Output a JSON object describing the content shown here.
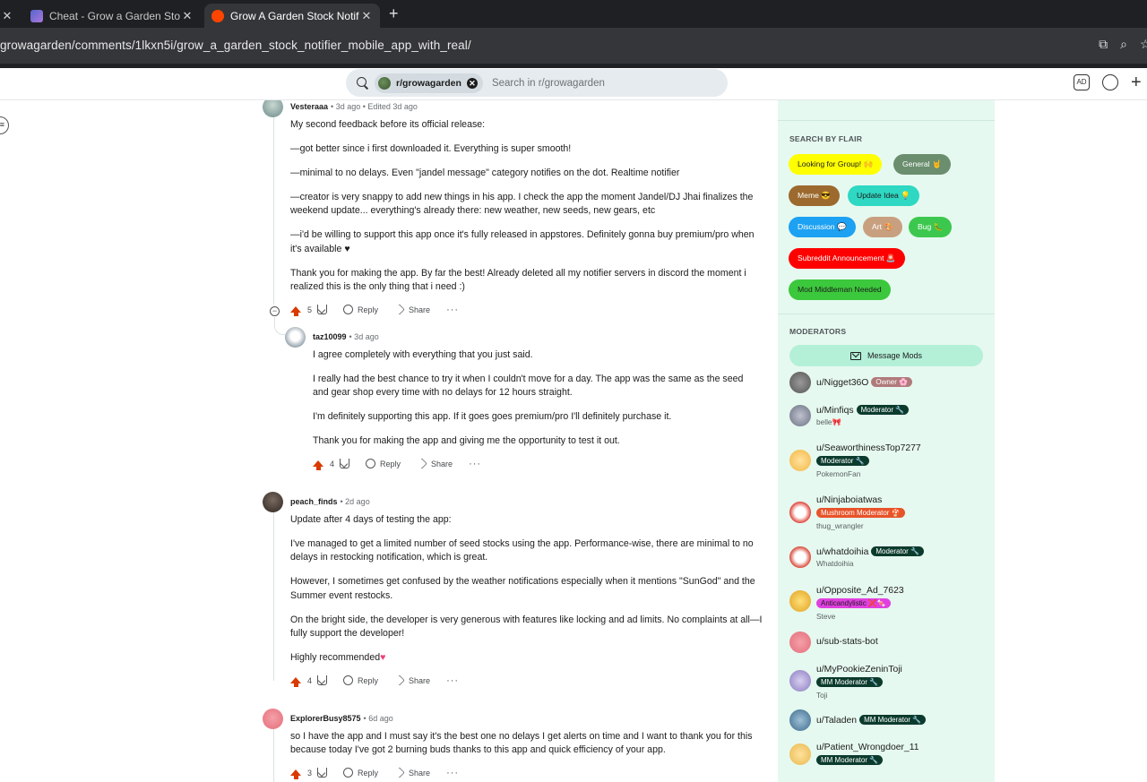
{
  "browser": {
    "tabs": [
      {
        "title": "",
        "close": "✕"
      },
      {
        "title": "Cheat - Grow a Garden Stock N",
        "close": "✕"
      },
      {
        "title": "Grow A Garden Stock Notifier M",
        "close": "✕"
      }
    ],
    "new_tab": "+",
    "url": "growagarden/comments/1lkxn5i/grow_a_garden_stock_notifier_mobile_app_with_real/"
  },
  "header": {
    "subreddit_chip": "r/growagarden",
    "chip_close": "✕",
    "search_placeholder": "Search in r/growagarden",
    "ad_icon_label": "AD",
    "create_label": "+"
  },
  "comments": [
    {
      "author": "Vesteraaa",
      "meta": "• 3d ago • Edited 3d ago",
      "paragraphs": [
        "My second feedback before its official release:",
        "—got better since i first downloaded it. Everything is super smooth!",
        "—minimal to no delays. Even \"jandel message\" category notifies on the dot. Realtime notifier",
        "—creator is very snappy to add new things in his app. I check the app the moment Jandel/DJ Jhai finalizes the weekend update... everything's already there: new weather, new seeds, new gears, etc",
        "—i'd be willing to support this app once it's fully released in appstores. Definitely gonna buy premium/pro when it's available ♥",
        "Thank you for making the app. By far the best! Already deleted all my notifier servers in discord the moment i realized this is the only thing that i need :)"
      ],
      "votes": "5",
      "reply": "Reply",
      "share": "Share",
      "more": "···"
    },
    {
      "author": "taz10099",
      "meta": "• 3d ago",
      "paragraphs": [
        "I agree completely with everything that you just said.",
        "I really had the best chance to try it when I couldn't move for a day. The app was the same as the seed and gear shop every time with no delays for 12 hours straight.",
        "I'm definitely supporting this app. If it goes goes premium/pro I'll definitely purchase it.",
        "Thank you for making the app and giving me the opportunity to test it out."
      ],
      "votes": "4",
      "reply": "Reply",
      "share": "Share",
      "more": "···"
    },
    {
      "author": "peach_finds",
      "meta": "• 2d ago",
      "paragraphs": [
        "Update after 4 days of testing the app:",
        "I've managed to get a limited number of seed stocks using the app. Performance-wise, there are minimal to no delays in restocking notification, which is great.",
        "However, I sometimes get confused by the weather notifications especially when it mentions \"SunGod\" and the Summer event restocks.",
        "On the bright side, the developer is very generous with features like locking and ad limits. No complaints at all—I fully support the developer!",
        "Highly recommended"
      ],
      "heart": "♥",
      "votes": "4",
      "reply": "Reply",
      "share": "Share",
      "more": "···"
    },
    {
      "author": "ExplorerBusy8575",
      "meta": "• 6d ago",
      "paragraphs": [
        "so I have the app and I must say it's the best one no delays I get alerts on time and I want to thank you for this because today I've got 2 burning buds thanks to this app and quick efficiency of your app."
      ],
      "votes": "3",
      "reply": "Reply",
      "share": "Share",
      "more": "···"
    }
  ],
  "sidebar": {
    "search_by_flair_title": "SEARCH BY FLAIR",
    "flairs": [
      {
        "label": "Looking for Group! 🙌",
        "bg": "#ffff00",
        "fg": "#1c1c1c"
      },
      {
        "label": "General 🤘",
        "bg": "#6a8e6e",
        "fg": "#ffffff"
      },
      {
        "label": "Meme 😎",
        "bg": "#9c6a2e",
        "fg": "#ffffff"
      },
      {
        "label": "Update Idea 💡",
        "bg": "#2ed8c2",
        "fg": "#1c1c1c"
      },
      {
        "label": "Discussion 💬",
        "bg": "#1da1f2",
        "fg": "#ffffff"
      },
      {
        "label": "Art 🎨",
        "bg": "#c8a080",
        "fg": "#ffffff"
      },
      {
        "label": "Bug 🐛",
        "bg": "#3cc84e",
        "fg": "#ffffff"
      },
      {
        "label": "Subreddit Announcement 🚨",
        "bg": "#ff0000",
        "fg": "#ffffff"
      },
      {
        "label": "Mod Middleman Needed",
        "bg": "#3cc83c",
        "fg": "#1c1c1c"
      }
    ],
    "moderators_title": "MODERATORS",
    "message_mods": "Message Mods",
    "mods": [
      {
        "name": "u/Nigget36O",
        "flair": "Owner 🌸",
        "flair_bg": "#b07a7a",
        "flair_fg": "#ffffff",
        "sub": ""
      },
      {
        "name": "u/Minfiqs",
        "flair": "Moderator 🔧",
        "flair_bg": "#0b3b2c",
        "flair_fg": "#ffffff",
        "sub": "belle🎀"
      },
      {
        "name": "u/SeaworthinessTop7277",
        "flair": "Moderator 🔧",
        "flair_bg": "#0b3b2c",
        "flair_fg": "#ffffff",
        "sub": "PokemonFan"
      },
      {
        "name": "u/Ninjaboiatwas",
        "flair": "Mushroom Moderator 🍄",
        "flair_bg": "#e8532a",
        "flair_fg": "#ffffff",
        "sub": "thug_wrangler"
      },
      {
        "name": "u/whatdoihia",
        "flair": "Moderator 🔧",
        "flair_bg": "#0b3b2c",
        "flair_fg": "#ffffff",
        "sub": "Whatdoihia"
      },
      {
        "name": "u/Opposite_Ad_7623",
        "flair": "Anticandylistic ❌🍬",
        "flair_bg": "#e040e0",
        "flair_fg": "#1c1c1c",
        "sub": "Steve"
      },
      {
        "name": "u/sub-stats-bot",
        "flair": "",
        "flair_bg": "",
        "flair_fg": "",
        "sub": ""
      },
      {
        "name": "u/MyPookieZeninToji",
        "flair": "MM Moderator 🔧",
        "flair_bg": "#0b3b2c",
        "flair_fg": "#ffffff",
        "sub": "Toji"
      },
      {
        "name": "u/Taladen",
        "flair": "MM Moderator 🔧",
        "flair_bg": "#0b3b2c",
        "flair_fg": "#ffffff",
        "sub": ""
      },
      {
        "name": "u/Patient_Wrongdoer_11",
        "flair": "MM Moderator 🔧",
        "flair_bg": "#0b3b2c",
        "flair_fg": "#ffffff",
        "sub": ""
      }
    ]
  },
  "colors": {
    "upvote": "#d93a00",
    "sidebar_bg": "#e6f9f0",
    "message_mods_bg": "#b4f0d8"
  }
}
